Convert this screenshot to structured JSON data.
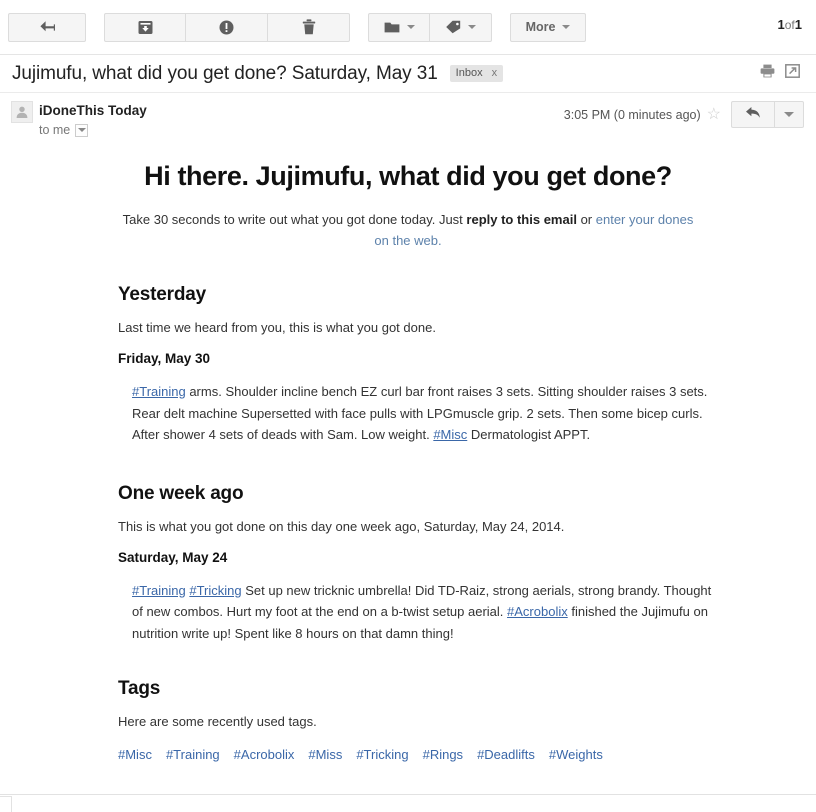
{
  "toolbar": {
    "back_icon": "back-arrow-icon",
    "archive_icon": "archive-icon",
    "spam_icon": "report-spam-icon",
    "delete_icon": "trash-icon",
    "move_icon": "folder-icon",
    "labels_icon": "label-tag-icon",
    "more_label": "More",
    "pager_current": "1",
    "pager_of": "of",
    "pager_total": "1"
  },
  "subject": {
    "text": "Jujimufu, what did you get done? Saturday, May 31",
    "label_chip": "Inbox",
    "label_chip_remove": "x",
    "print_icon": "print-icon",
    "popout_icon": "open-in-new-window-icon"
  },
  "message": {
    "sender": "iDoneThis Today",
    "recipient": "to me",
    "timestamp": "3:05 PM (0 minutes ago)",
    "star_glyph": "☆",
    "reply_icon": "reply-arrow-icon"
  },
  "body": {
    "hero_title": "Hi there. Jujimufu, what did you get done?",
    "intro_part1": "Take 30 seconds to write out what you got done today. Just ",
    "intro_bold": "reply to this email",
    "intro_part2": " or ",
    "intro_link": "enter your dones on the web.",
    "yesterday": {
      "heading": "Yesterday",
      "intro": "Last time we heard from you, this is what you got done.",
      "date": "Friday, May 30",
      "entry_tag1": "#Training",
      "entry_text1": " arms. Shoulder incline bench EZ curl bar front raises 3 sets. Sitting shoulder raises 3 sets. Rear delt machine Supersetted with face pulls with LPGmuscle grip. 2 sets. Then some bicep curls. After shower 4 sets of deads with Sam. Low weight. ",
      "entry_tag2": "#Misc",
      "entry_text2": " Dermatologist APPT."
    },
    "one_week_ago": {
      "heading": "One week ago",
      "intro": "This is what you got done on this day one week ago, Saturday, May 24, 2014.",
      "date": "Saturday, May 24",
      "entry_tag1": "#Training",
      "entry_tag2": "#Tricking",
      "entry_text1": " Set up new tricknic umbrella! Did TD-Raiz, strong aerials, strong brandy. Thought of new combos. Hurt my foot at the end on a b-twist setup aerial. ",
      "entry_tag3": "#Acrobolix",
      "entry_text2": " finished the Jujimufu on nutrition write up! Spent like 8 hours on that damn thing!"
    },
    "tags_section": {
      "heading": "Tags",
      "intro": "Here are some recently used tags.",
      "tags": [
        "#Misc",
        "#Training",
        "#Acrobolix",
        "#Miss",
        "#Tricking",
        "#Rings",
        "#Deadlifts",
        "#Weights"
      ]
    }
  },
  "colors": {
    "tag_link": "#3a67a8",
    "soft_link": "#5d82ab",
    "button_face": "#f5f5f5",
    "border": "#dcdcdc"
  }
}
